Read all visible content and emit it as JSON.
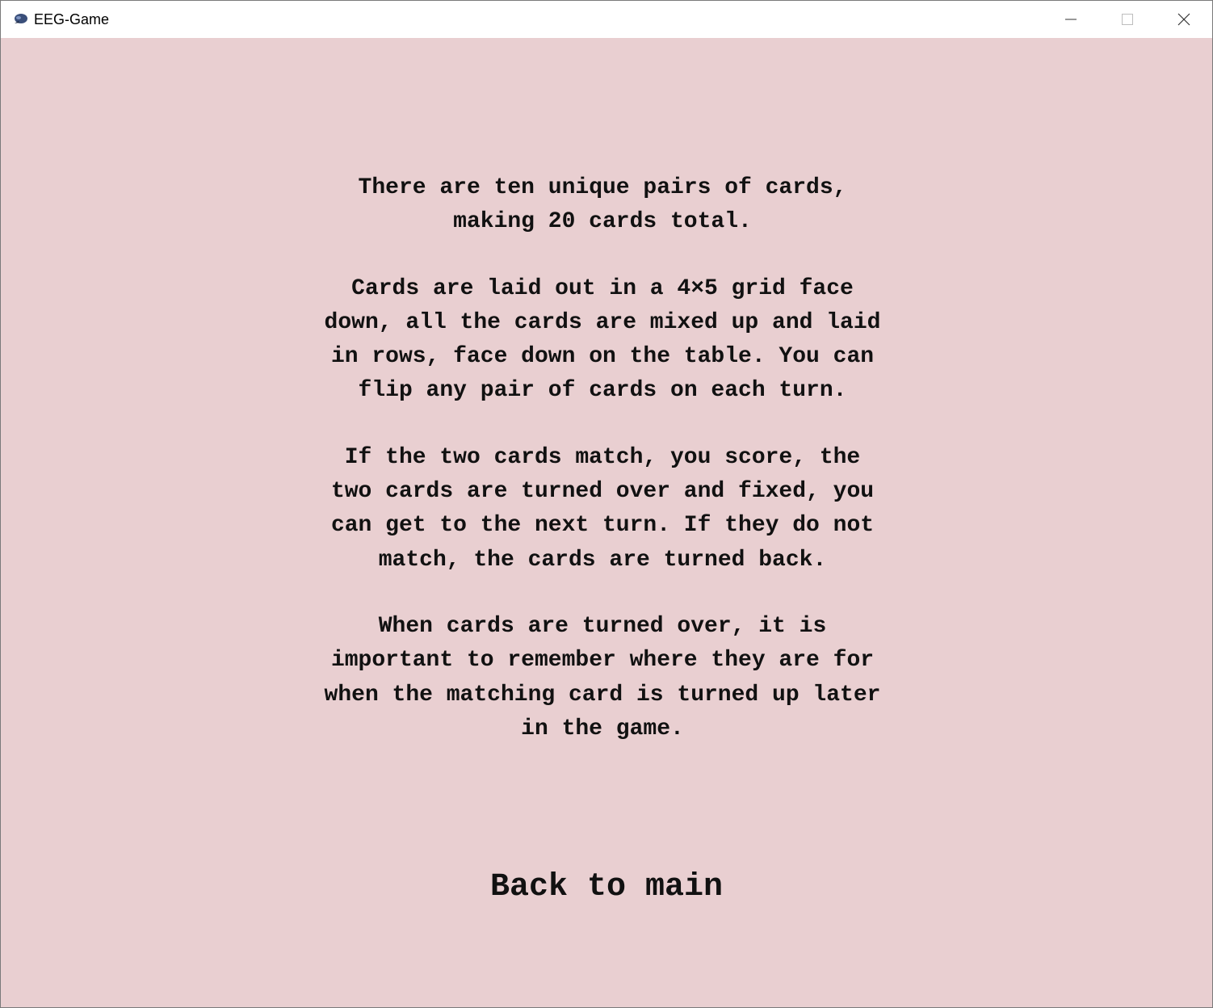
{
  "window": {
    "title": "EEG-Game",
    "icon": "brain-app-icon",
    "background_color": "#e9cfd1"
  },
  "titlebar_buttons": {
    "minimize_icon": "minimize-icon",
    "maximize_icon": "maximize-icon",
    "close_icon": "close-icon"
  },
  "instructions": {
    "paragraph_1": "There are ten unique pairs of cards,\nmaking 20 cards total.",
    "paragraph_2": "Cards are laid out in a 4×5 grid face\ndown, all the cards are mixed up and laid\nin rows, face down on the table. You can\nflip any pair of cards on each turn.",
    "paragraph_3": "If the two cards match, you score, the\ntwo cards are turned over and fixed, you\ncan get to the next turn. If they do not\nmatch, the cards are turned back.",
    "paragraph_4": "When cards are turned over, it is\nimportant to remember where they are for\nwhen the matching card is turned up later\nin the game."
  },
  "back_button": {
    "label": "Back to main"
  }
}
